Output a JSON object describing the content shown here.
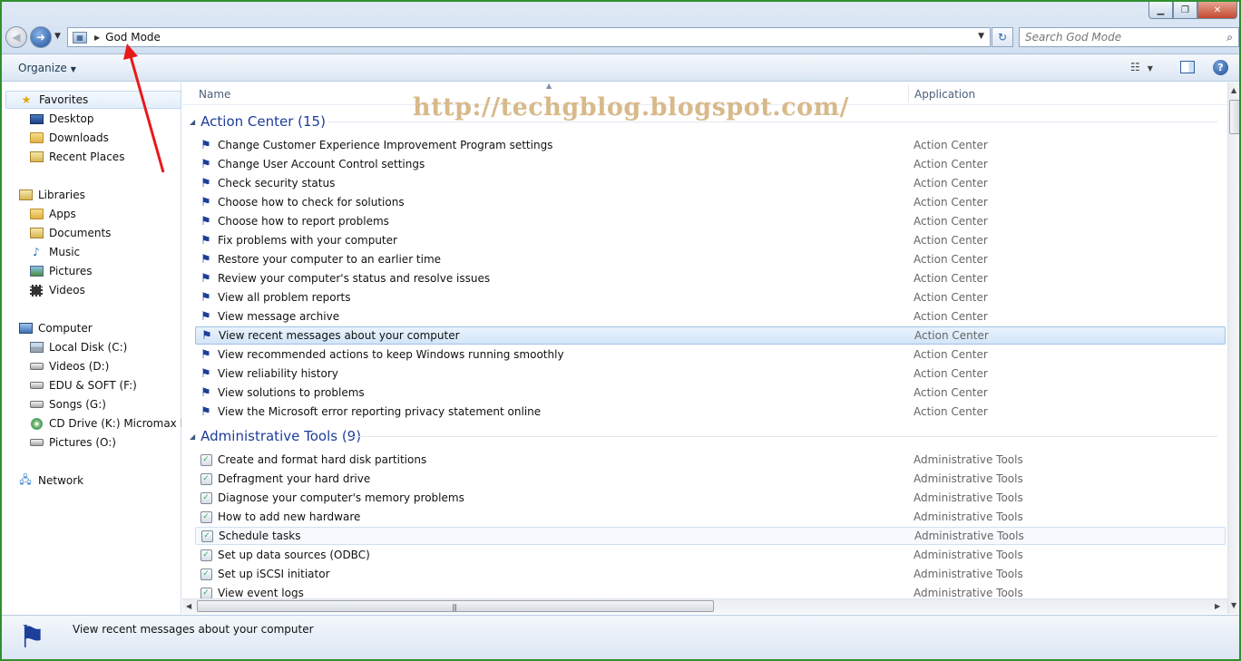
{
  "address": {
    "crumb": "God Mode"
  },
  "search": {
    "placeholder": "Search God Mode"
  },
  "toolbar": {
    "organize": "Organize"
  },
  "nav": {
    "favorites": "Favorites",
    "favorites_items": [
      "Desktop",
      "Downloads",
      "Recent Places"
    ],
    "libraries": "Libraries",
    "libraries_items": [
      "Apps",
      "Documents",
      "Music",
      "Pictures",
      "Videos"
    ],
    "computer": "Computer",
    "computer_items": [
      "Local Disk (C:)",
      "Videos (D:)",
      "EDU & SOFT (F:)",
      "Songs (G:)",
      "CD Drive (K:) Micromax Mo",
      "Pictures (O:)"
    ],
    "network": "Network"
  },
  "columns": {
    "name": "Name",
    "application": "Application"
  },
  "watermark": "http://techgblog.blogspot.com/",
  "groups": [
    {
      "title": "Action Center (15)",
      "items": [
        {
          "name": "Change Customer Experience Improvement Program settings",
          "app": "Action Center"
        },
        {
          "name": "Change User Account Control settings",
          "app": "Action Center"
        },
        {
          "name": "Check security status",
          "app": "Action Center"
        },
        {
          "name": "Choose how to check for solutions",
          "app": "Action Center"
        },
        {
          "name": "Choose how to report problems",
          "app": "Action Center"
        },
        {
          "name": "Fix problems with your computer",
          "app": "Action Center"
        },
        {
          "name": "Restore your computer to an earlier time",
          "app": "Action Center"
        },
        {
          "name": "Review your computer's status and resolve issues",
          "app": "Action Center"
        },
        {
          "name": "View all problem reports",
          "app": "Action Center"
        },
        {
          "name": "View message archive",
          "app": "Action Center"
        },
        {
          "name": "View recent messages about your computer",
          "app": "Action Center"
        },
        {
          "name": "View recommended actions to keep Windows running smoothly",
          "app": "Action Center"
        },
        {
          "name": "View reliability history",
          "app": "Action Center"
        },
        {
          "name": "View solutions to problems",
          "app": "Action Center"
        },
        {
          "name": "View the Microsoft error reporting privacy statement online",
          "app": "Action Center"
        }
      ]
    },
    {
      "title": "Administrative Tools (9)",
      "items": [
        {
          "name": "Create and format hard disk partitions",
          "app": "Administrative Tools"
        },
        {
          "name": "Defragment your hard drive",
          "app": "Administrative Tools"
        },
        {
          "name": "Diagnose your computer's memory problems",
          "app": "Administrative Tools"
        },
        {
          "name": "How to add new hardware",
          "app": "Administrative Tools"
        },
        {
          "name": "Schedule tasks",
          "app": "Administrative Tools"
        },
        {
          "name": "Set up data sources (ODBC)",
          "app": "Administrative Tools"
        },
        {
          "name": "Set up iSCSI initiator",
          "app": "Administrative Tools"
        },
        {
          "name": "View event logs",
          "app": "Administrative Tools"
        }
      ]
    }
  ],
  "details": {
    "text": "View recent messages about your computer"
  },
  "icons": {
    "action_center": "flag-icon",
    "admin_tools": "admin-tool-icon"
  }
}
